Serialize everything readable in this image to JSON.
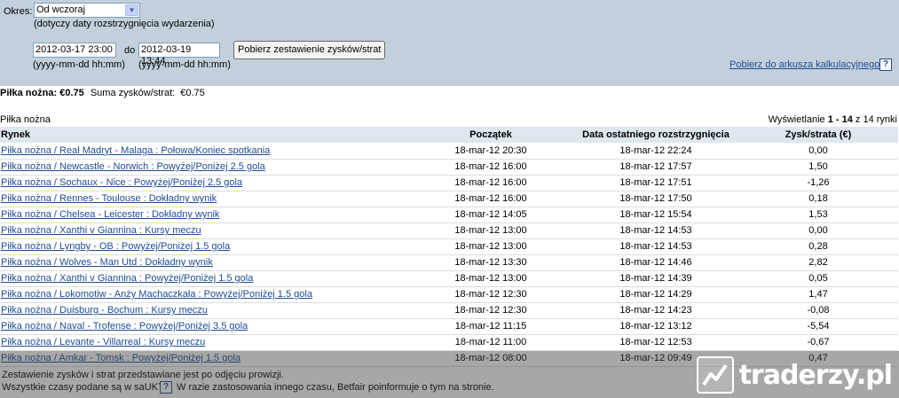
{
  "filters": {
    "okres_label": "Okres:",
    "okres_selected": "Od wczoraj",
    "okres_note": "(dotyczy daty rozstrzygnięcia wydarzenia)",
    "date_from": "2012-03-17 23:00",
    "do_label": "do",
    "date_to": "2012-03-19 13:44",
    "date_format_from": "(yyyy-mm-dd hh:mm)",
    "date_format_to": "(yyyy-mm-dd hh:mm)",
    "submit_label": "Pobierz zestawienie zysków/strat",
    "export_link": "Pobierz do arkusza kalkulacyjnego",
    "help_glyph": "?"
  },
  "summary": {
    "sport_label": "Piłka nożna: €0.75",
    "total_label": "Suma zysków/strat:",
    "total_value": "€0.75"
  },
  "list": {
    "section_label": "Piłka nożna",
    "counter_prefix": "Wyświetlanie",
    "counter_range": "1 - 14",
    "counter_suffix": "z 14 rynki"
  },
  "table": {
    "headers": [
      "Rynek",
      "Początek",
      "Data ostatniego rozstrzygnięcia",
      "Zysk/strata (€)"
    ],
    "rows": [
      {
        "market": "Piłka nożna / Real Madryt - Malaga : Połowa/Koniec spotkania",
        "start": "18-mar-12 20:30",
        "settled": "18-mar-12 22:24",
        "pl": "0,00"
      },
      {
        "market": "Piłka nożna / Newcastle - Norwich : Powyżej/Poniżej 2.5 gola",
        "start": "18-mar-12 16:00",
        "settled": "18-mar-12 17:57",
        "pl": "1,50"
      },
      {
        "market": "Piłka nożna / Sochaux - Nice : Powyżej/Poniżej 2.5 gola",
        "start": "18-mar-12 16:00",
        "settled": "18-mar-12 17:51",
        "pl": "-1,26"
      },
      {
        "market": "Piłka nożna / Rennes - Toulouse : Dokładny wynik",
        "start": "18-mar-12 16:00",
        "settled": "18-mar-12 17:50",
        "pl": "0,18"
      },
      {
        "market": "Piłka nożna / Chelsea - Leicester : Dokładny wynik",
        "start": "18-mar-12 14:05",
        "settled": "18-mar-12 15:54",
        "pl": "1,53"
      },
      {
        "market": "Piłka nożna / Xanthi v Giannina : Kursy meczu",
        "start": "18-mar-12 13:00",
        "settled": "18-mar-12 14:53",
        "pl": "0,00"
      },
      {
        "market": "Piłka nożna / Lyngby - OB : Powyżej/Poniżej 1.5 gola",
        "start": "18-mar-12 13:00",
        "settled": "18-mar-12 14:53",
        "pl": "0,28"
      },
      {
        "market": "Piłka nożna / Wolves - Man Utd : Dokładny wynik",
        "start": "18-mar-12 13:30",
        "settled": "18-mar-12 14:46",
        "pl": "2,82"
      },
      {
        "market": "Piłka nożna / Xanthi v Giannina : Powyżej/Poniżej 1.5 gola",
        "start": "18-mar-12 13:00",
        "settled": "18-mar-12 14:39",
        "pl": "0,05"
      },
      {
        "market": "Piłka nożna / Lokomotiw - Anży Machaczkała : Powyżej/Poniżej 1.5 gola",
        "start": "18-mar-12 12:30",
        "settled": "18-mar-12 14:29",
        "pl": "1,47"
      },
      {
        "market": "Piłka nożna / Duisburg - Bochum : Kursy meczu",
        "start": "18-mar-12 12:30",
        "settled": "18-mar-12 14:23",
        "pl": "-0,08"
      },
      {
        "market": "Piłka nożna / Naval - Trofense : Powyżej/Poniżej 3.5 gola",
        "start": "18-mar-12 11:15",
        "settled": "18-mar-12 13:12",
        "pl": "-5,54"
      },
      {
        "market": "Piłka nożna / Levante - Villarreal : Kursy meczu",
        "start": "18-mar-12 11:00",
        "settled": "18-mar-12 12:53",
        "pl": "-0,67"
      },
      {
        "market": "Piłka nożna / Amkar - Tomsk : Powyżej/Poniżej 1.5 gola",
        "start": "18-mar-12 08:00",
        "settled": "18-mar-12 09:49",
        "pl": "0,47"
      }
    ]
  },
  "footer": {
    "note1": "Zestawienie zysków i strat przedstawiane jest po odjęciu prowizji.",
    "note2": "Wszystkie czasy podane są w saUKT",
    "note2b": "W razie zastosowania innego czasu, Betfair poinformuje o tym na stronie."
  },
  "watermark": {
    "text": "traderzy.pl"
  }
}
